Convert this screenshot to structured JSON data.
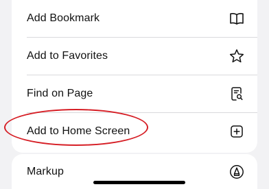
{
  "menu": {
    "items": [
      {
        "label": "Add Bookmark",
        "icon": "book-icon"
      },
      {
        "label": "Add to Favorites",
        "icon": "star-icon"
      },
      {
        "label": "Find on Page",
        "icon": "find-on-page-icon"
      },
      {
        "label": "Add to Home Screen",
        "icon": "add-square-icon",
        "highlighted": true
      }
    ],
    "markup": {
      "label": "Markup",
      "icon": "markup-pen-icon"
    }
  },
  "colors": {
    "background": "#f2f2f4",
    "card": "#ffffff",
    "highlight": "#d61e25"
  }
}
